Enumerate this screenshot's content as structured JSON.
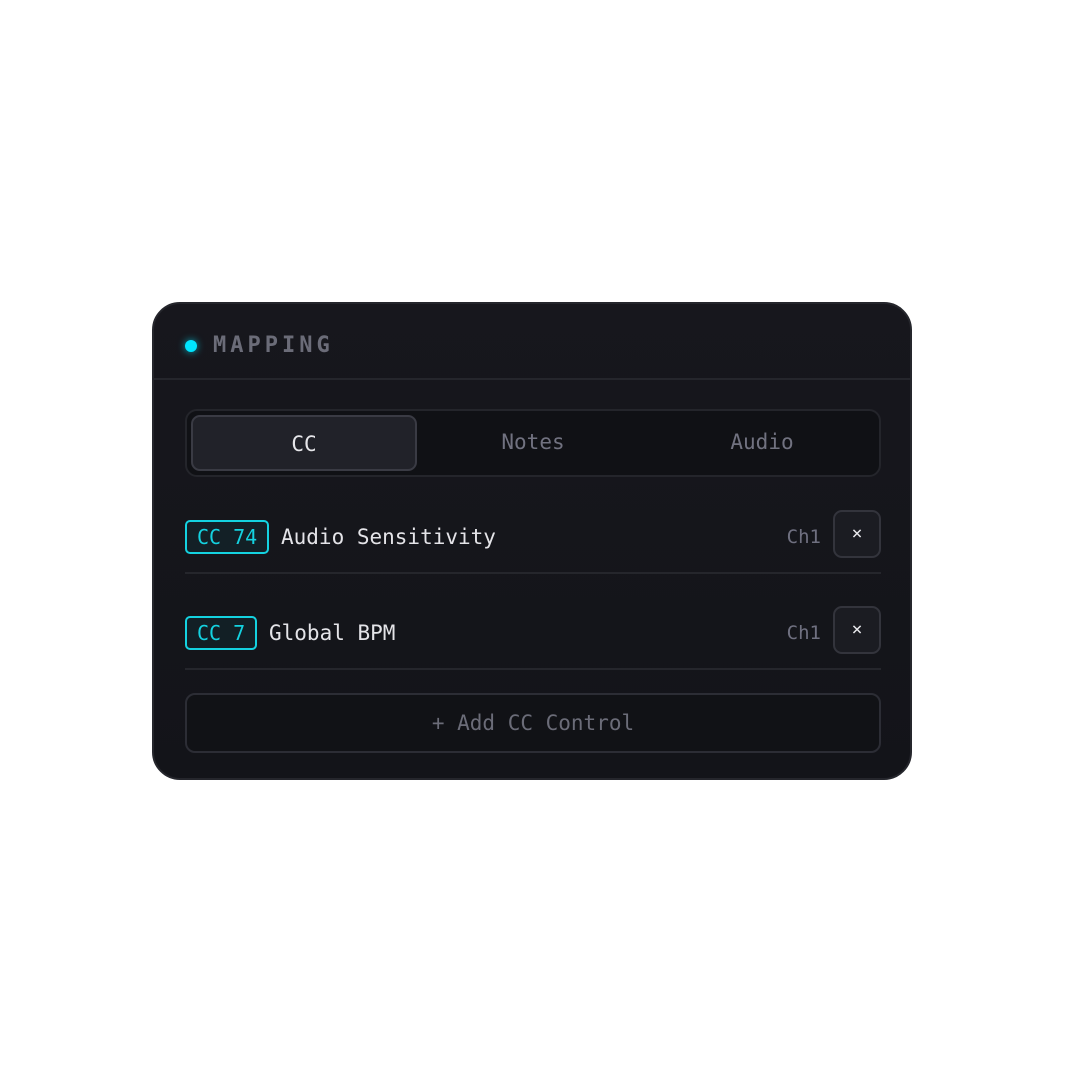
{
  "header": {
    "title": "MAPPING",
    "status_color": "#00e5ff"
  },
  "tabs": [
    {
      "label": "CC",
      "active": true
    },
    {
      "label": "Notes",
      "active": false
    },
    {
      "label": "Audio",
      "active": false
    }
  ],
  "mappings": [
    {
      "badge": "CC 74",
      "name": "Audio Sensitivity",
      "channel": "Ch1",
      "remove_label": "×"
    },
    {
      "badge": "CC 7",
      "name": "Global BPM",
      "channel": "Ch1",
      "remove_label": "×"
    }
  ],
  "add_button": {
    "label": "+ Add CC Control"
  },
  "colors": {
    "accent": "#14d2e0",
    "panel_bg": "#15161b"
  }
}
